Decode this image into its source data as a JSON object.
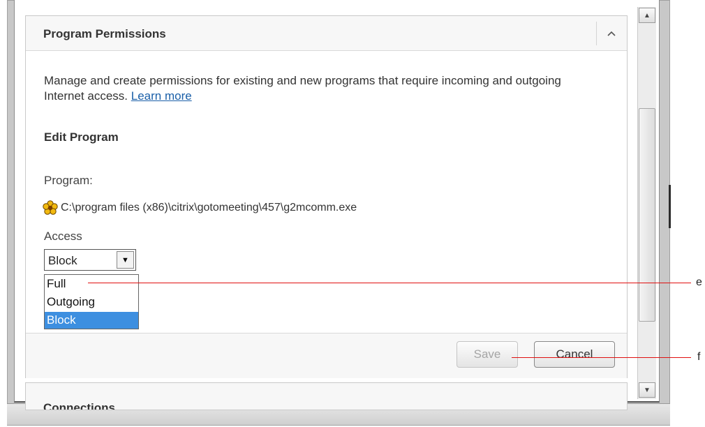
{
  "panel": {
    "title": "Program Permissions",
    "collapse_icon": "chevron-up-icon",
    "description": "Manage and create permissions for existing and new programs that require incoming and outgoing Internet access.",
    "learn_more": "Learn more",
    "section_title": "Edit Program",
    "program_label": "Program:",
    "program_icon": "program-flower-icon",
    "program_path": "C:\\program files (x86)\\citrix\\gotomeeting\\457\\g2mcomm.exe",
    "access_label": "Access",
    "access_select": {
      "value": "Block",
      "options": [
        "Full",
        "Outgoing",
        "Block"
      ],
      "highlighted": "Block"
    },
    "save_label": "Save",
    "cancel_label": "Cancel"
  },
  "next_panel": {
    "title": "Connections"
  },
  "callouts": {
    "e": "e",
    "f": "f"
  },
  "colors": {
    "link": "#1a5fa8",
    "highlight": "#3d8fe0",
    "callout_line": "#e01010"
  }
}
